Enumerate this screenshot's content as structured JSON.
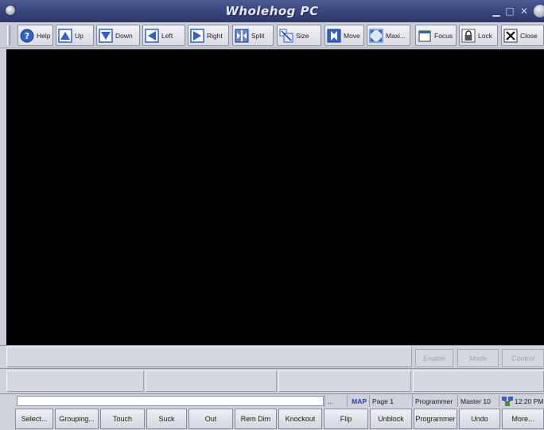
{
  "window": {
    "title": "Wholehog PC"
  },
  "toolbar": {
    "buttons": [
      {
        "id": "help",
        "label": "Help",
        "icon": "help-icon"
      },
      {
        "id": "up",
        "label": "Up",
        "icon": "arrow-up-icon"
      },
      {
        "id": "down",
        "label": "Down",
        "icon": "arrow-down-icon"
      },
      {
        "id": "left",
        "label": "Left",
        "icon": "arrow-left-icon"
      },
      {
        "id": "right",
        "label": "Right",
        "icon": "arrow-right-icon"
      },
      {
        "id": "split",
        "label": "Split",
        "icon": "split-icon"
      },
      {
        "id": "size",
        "label": "Size",
        "icon": "size-icon"
      },
      {
        "id": "move",
        "label": "Move",
        "icon": "move-icon"
      },
      {
        "id": "max",
        "label": "Maxi...",
        "icon": "maximize-icon"
      },
      {
        "id": "focus",
        "label": "Focus",
        "icon": "focus-icon"
      },
      {
        "id": "lock",
        "label": "Lock",
        "icon": "lock-icon"
      },
      {
        "id": "close",
        "label": "Close",
        "icon": "close-x-icon"
      }
    ]
  },
  "controls": {
    "enable": "Enable",
    "mode": "Mode",
    "control": "Control"
  },
  "status": {
    "dots": "...",
    "map": "MAP",
    "page": "Page 1",
    "editor": "Programmer",
    "master": "Master 10",
    "time": "12:20 PM"
  },
  "bottom": {
    "buttons": [
      "Select...",
      "Grouping...",
      "Touch",
      "Suck",
      "Out",
      "Rem Dim",
      "Knockout",
      "Flip",
      "Unblock",
      "Programmer",
      "Undo",
      "More..."
    ]
  },
  "colors": {
    "titlebar": "#3b477f",
    "toolbar": "#c9ccd6",
    "accent_blue": "#2f62c4",
    "view_bg": "#000000"
  }
}
